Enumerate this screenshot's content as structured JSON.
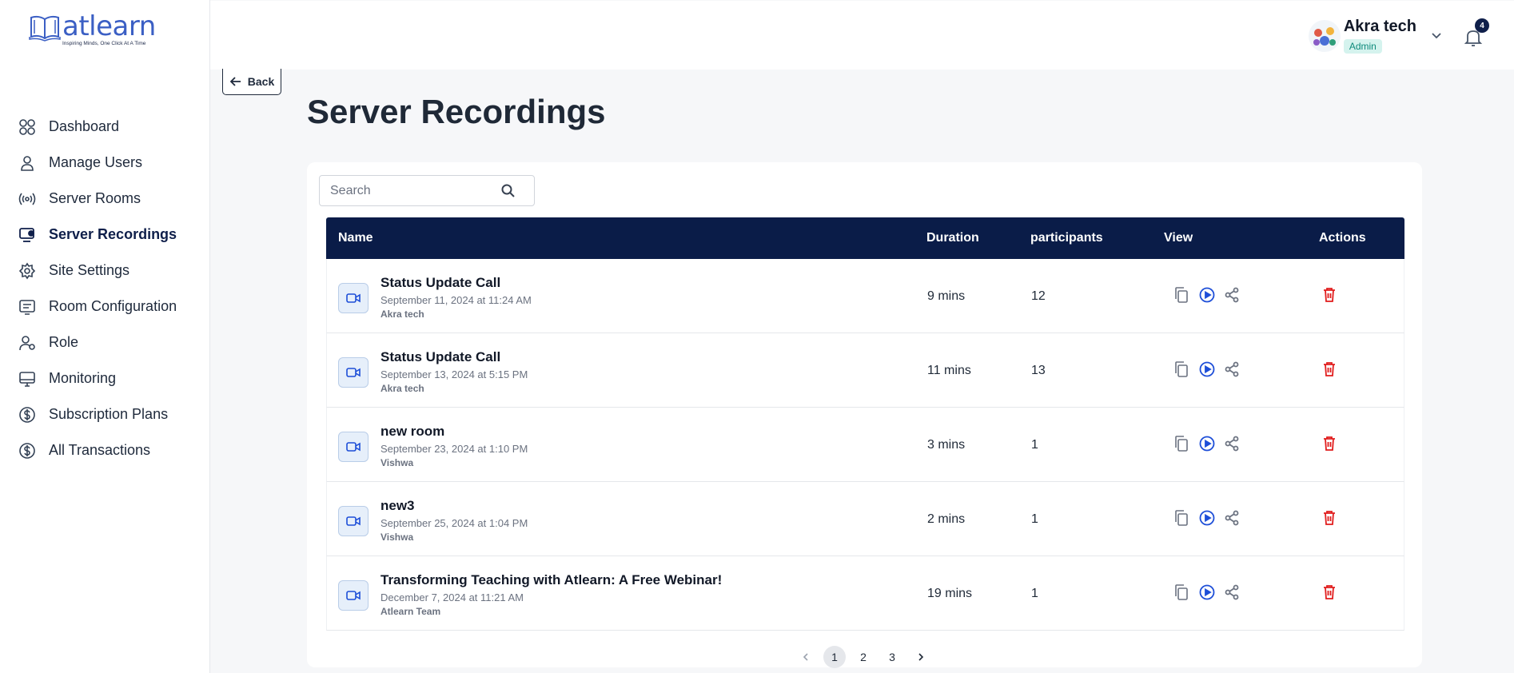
{
  "brand": {
    "name": "atlearn",
    "tagline": "Inspiring Minds, One Click At A Time",
    "color": "#3b5fc4"
  },
  "sidebar": {
    "items": [
      {
        "label": "Dashboard",
        "icon": "dashboard-icon",
        "active": false
      },
      {
        "label": "Manage Users",
        "icon": "user-icon",
        "active": false
      },
      {
        "label": "Server Rooms",
        "icon": "broadcast-icon",
        "active": false
      },
      {
        "label": "Server Recordings",
        "icon": "recordings-icon",
        "active": true
      },
      {
        "label": "Site Settings",
        "icon": "gear-icon",
        "active": false
      },
      {
        "label": "Room Configuration",
        "icon": "config-icon",
        "active": false
      },
      {
        "label": "Role",
        "icon": "role-icon",
        "active": false
      },
      {
        "label": "Monitoring",
        "icon": "monitor-icon",
        "active": false
      },
      {
        "label": "Subscription Plans",
        "icon": "dollar-icon",
        "active": false
      },
      {
        "label": "All Transactions",
        "icon": "dollar-icon",
        "active": false
      }
    ]
  },
  "header": {
    "user_name": "Akra tech",
    "user_role": "Admin",
    "notification_count": "4"
  },
  "back_label": "Back",
  "page_title": "Server Recordings",
  "search": {
    "placeholder": "Search"
  },
  "table": {
    "columns": {
      "name": "Name",
      "duration": "Duration",
      "participants": "participants",
      "view": "View",
      "actions": "Actions"
    },
    "rows": [
      {
        "title": "Status Update Call",
        "date": "September 11, 2024 at 11:24 AM",
        "owner": "Akra tech",
        "duration": "9 mins",
        "participants": "12"
      },
      {
        "title": "Status Update Call",
        "date": "September 13, 2024 at 5:15 PM",
        "owner": "Akra tech",
        "duration": "11 mins",
        "participants": "13"
      },
      {
        "title": "new room",
        "date": "September 23, 2024 at 1:10 PM",
        "owner": "Vishwa",
        "duration": "3 mins",
        "participants": "1"
      },
      {
        "title": "new3",
        "date": "September 25, 2024 at 1:04 PM",
        "owner": "Vishwa",
        "duration": "2 mins",
        "participants": "1"
      },
      {
        "title": "Transforming Teaching with Atlearn: A Free Webinar!",
        "date": "December 7, 2024 at 11:21 AM",
        "owner": "Atlearn Team",
        "duration": "19 mins",
        "participants": "1"
      }
    ]
  },
  "pagination": {
    "pages": [
      "1",
      "2",
      "3"
    ],
    "current": "1"
  },
  "colors": {
    "header_bg": "#0a1c48",
    "delete": "#e11d1d",
    "play": "#1d4ed8",
    "badge_bg": "#d5f3ee"
  }
}
